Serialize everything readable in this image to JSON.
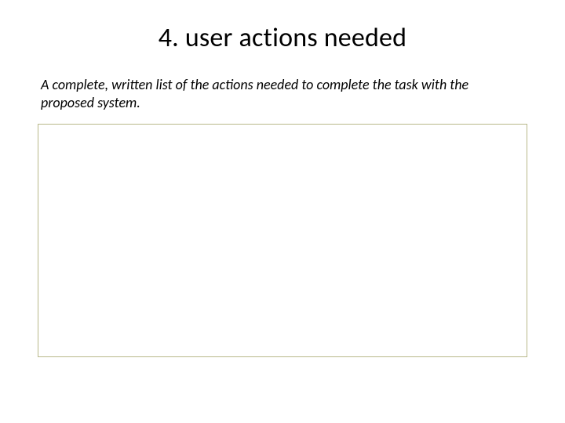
{
  "slide": {
    "title": "4. user actions needed",
    "description": "A complete, written list of the actions needed to complete the task with the proposed system."
  },
  "colors": {
    "box_border": "#b8b88a"
  }
}
